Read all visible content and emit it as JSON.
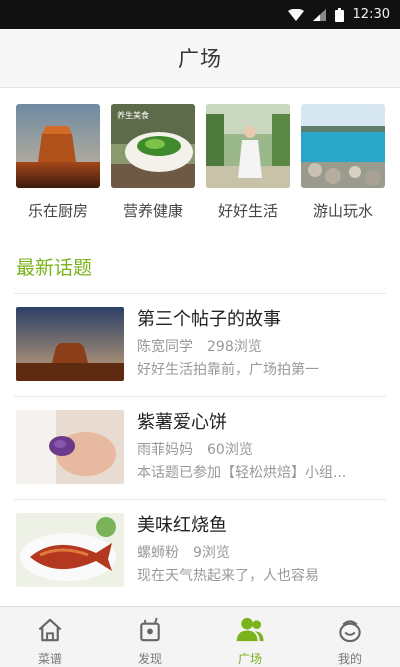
{
  "status_bar": {
    "time": "12:30"
  },
  "header": {
    "title": "广场"
  },
  "categories": [
    {
      "label": "乐在厨房",
      "icon": "mesa-photo"
    },
    {
      "label": "营养健康",
      "icon": "salad-bowl-photo",
      "overlay_text": "养生美食"
    },
    {
      "label": "好好生活",
      "icon": "woman-garden-photo"
    },
    {
      "label": "游山玩水",
      "icon": "lake-photo"
    }
  ],
  "section": {
    "title": "最新话题"
  },
  "topics": [
    {
      "title": "第三个帖子的故事",
      "author": "陈宽同学",
      "views": "298浏览",
      "excerpt": "好好生活拍靠前，广场拍第一"
    },
    {
      "title": "紫薯爱心饼",
      "author": "雨菲妈妈",
      "views": "60浏览",
      "excerpt": "本话题已参加【轻松烘焙】小组..."
    },
    {
      "title": "美味红烧鱼",
      "author": "螺蛳粉",
      "views": "9浏览",
      "excerpt": "现在天气热起来了，人也容易"
    }
  ],
  "tabs": [
    {
      "label": "菜谱",
      "icon": "home-icon",
      "active": false
    },
    {
      "label": "发现",
      "icon": "discover-icon",
      "active": false
    },
    {
      "label": "广场",
      "icon": "people-icon",
      "active": true
    },
    {
      "label": "我的",
      "icon": "profile-icon",
      "active": false
    }
  ],
  "colors": {
    "accent": "#7ab31c",
    "status_bar": "#111111",
    "header_bg": "#f7f7f7"
  }
}
